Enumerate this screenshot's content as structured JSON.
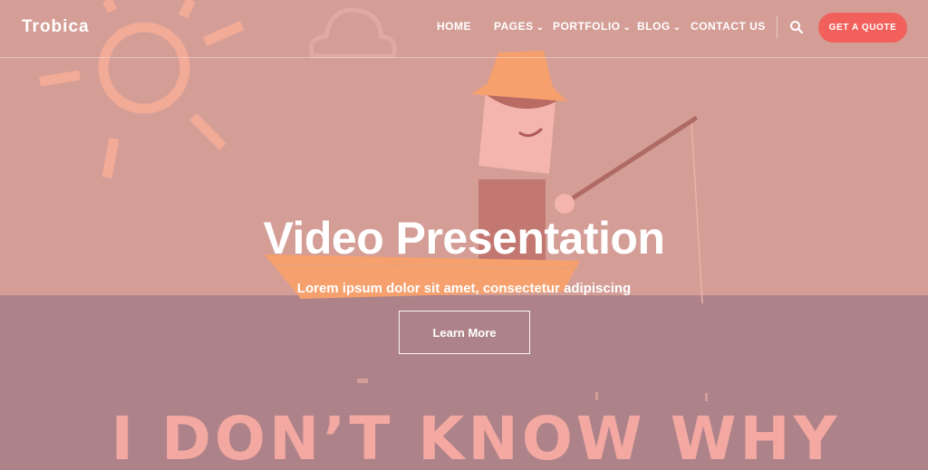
{
  "brand": {
    "name": "Trobica"
  },
  "nav": {
    "items": [
      {
        "label": "HOME",
        "has_dropdown": false
      },
      {
        "label": "PAGES",
        "has_dropdown": true
      },
      {
        "label": "PORTFOLIO",
        "has_dropdown": true
      },
      {
        "label": "BLOG",
        "has_dropdown": true
      },
      {
        "label": "CONTACT US",
        "has_dropdown": false
      }
    ],
    "search_icon": "search-icon",
    "cta_label": "GET A QUOTE"
  },
  "hero": {
    "title": "Video Presentation",
    "subtitle": "Lorem ipsum dolor sit amet, consectetur adipiscing",
    "button_label": "Learn More",
    "background_caption": "I DON’T KNOW WHY"
  },
  "colors": {
    "sky": "#d49e97",
    "water": "#ad8389",
    "accent_orange": "#f5a06d",
    "cta_red": "#f1605b",
    "sun_stroke": "#f2ab97"
  }
}
